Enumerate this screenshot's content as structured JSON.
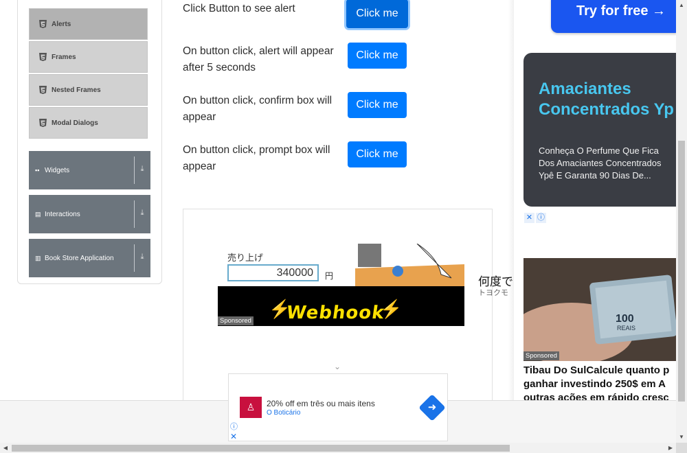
{
  "sidebar": {
    "sub_items": [
      {
        "label": "Alerts",
        "active": true
      },
      {
        "label": "Frames",
        "active": false
      },
      {
        "label": "Nested Frames",
        "active": false
      },
      {
        "label": "Modal Dialogs",
        "active": false
      }
    ],
    "groups": [
      {
        "label": "Widgets",
        "icon": "grid-icon"
      },
      {
        "label": "Interactions",
        "icon": "list-icon"
      },
      {
        "label": "Book Store Application",
        "icon": "books-icon"
      }
    ]
  },
  "alerts": [
    {
      "text": "Click Button to see alert",
      "button": "Click me"
    },
    {
      "text": "On button click, alert will appear after 5 seconds",
      "button": "Click me"
    },
    {
      "text": "On button click, confirm box will appear",
      "button": "Click me"
    },
    {
      "text": "On button click, prompt box will appear",
      "button": "Click me"
    }
  ],
  "webhook_ad": {
    "label": "売り上げ",
    "value": "340000",
    "unit": "円",
    "logo": "Webhook",
    "sponsored": "Sponsored",
    "side_title": "何度で",
    "side_sub": "トヨクモ"
  },
  "right_ads": {
    "try_button": "Try for free →",
    "dark_title_line1": "Amaciantes",
    "dark_title_line2": "Concentrados Yp",
    "dark_desc": "Conheça O Perfume Que Fica Dos Amaciantes Concentrados Ypê E Garanta 90 Dias De...",
    "money_sponsored": "Sponsored",
    "money_bill": "100",
    "money_bill_sub": "REAIS",
    "news_title_1": "Tibau Do SulCalcule quanto p",
    "news_title_2": "ganhar investindo 250$ em A",
    "news_title_3": "outras ações em rápido cresc"
  },
  "bottom_ad": {
    "title": "20% off em três ou mais itens",
    "brand": "O Boticário"
  },
  "colors": {
    "primary": "#007bff",
    "group_bg": "#6c757d",
    "ad_title": "#48c7ef"
  }
}
